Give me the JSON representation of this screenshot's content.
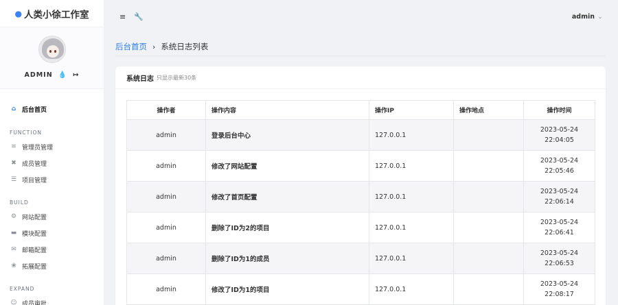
{
  "brand": {
    "icon": "flame-icon",
    "name": "人类小徐工作室"
  },
  "profile": {
    "username": "ADMIN",
    "icons": [
      "flame-icon",
      "logout-icon"
    ]
  },
  "nav": {
    "home": "后台首页",
    "section_function": "FUNCTION",
    "function_items": [
      "管理员管理",
      "成员管理",
      "项目管理"
    ],
    "section_build": "BUILD",
    "build_items": [
      "网站配置",
      "模块配置",
      "邮箱配置",
      "拓展配置"
    ],
    "section_expand": "EXPAND",
    "expand_items": [
      "成员审批"
    ]
  },
  "topbar": {
    "menu_icon": "≡",
    "tool_icon": "wrench-icon",
    "user": "admin"
  },
  "breadcrumb": {
    "home": "后台首页",
    "separator": "›",
    "current": "系统日志列表"
  },
  "card": {
    "title": "系统日志",
    "subtitle": "只显示最新30条",
    "columns": [
      "操作者",
      "操作内容",
      "操作IP",
      "操作地点",
      "操作时间"
    ],
    "rows": [
      {
        "operator": "admin",
        "content": "登录后台中心",
        "ip": "127.0.0.1",
        "location": "",
        "date": "2023-05-24",
        "time": "22:04:05"
      },
      {
        "operator": "admin",
        "content": "修改了网站配置",
        "ip": "127.0.0.1",
        "location": "",
        "date": "2023-05-24",
        "time": "22:05:46"
      },
      {
        "operator": "admin",
        "content": "修改了首页配置",
        "ip": "127.0.0.1",
        "location": "",
        "date": "2023-05-24",
        "time": "22:06:14"
      },
      {
        "operator": "admin",
        "content": "删除了ID为2的项目",
        "ip": "127.0.0.1",
        "location": "",
        "date": "2023-05-24",
        "time": "22:06:41"
      },
      {
        "operator": "admin",
        "content": "删除了ID为1的成员",
        "ip": "127.0.0.1",
        "location": "",
        "date": "2023-05-24",
        "time": "22:06:53"
      },
      {
        "operator": "admin",
        "content": "修改了ID为1的项目",
        "ip": "127.0.0.1",
        "location": "",
        "date": "2023-05-24",
        "time": "22:08:17"
      }
    ]
  },
  "colors": {
    "accent": "#2b7de9",
    "sidebar_bg": "#ffffff",
    "page_bg": "#f0f2f5"
  }
}
